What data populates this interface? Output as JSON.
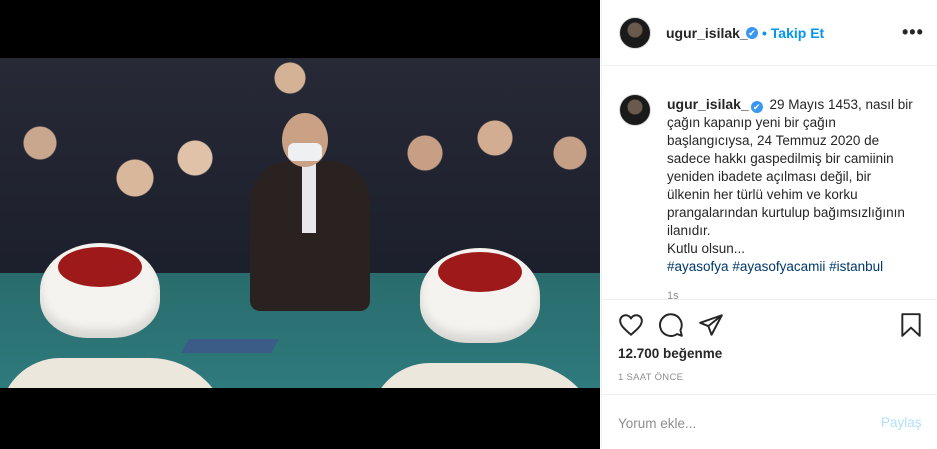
{
  "post": {
    "username": "ugur_isilak_",
    "follow_separator": "•",
    "follow_label": "Takip Et",
    "more_label": "•••",
    "verified_icon": "✔",
    "caption_text": "29 Mayıs 1453, nasıl bir çağın kapanıp yeni bir çağın başlangıcıysa, 24 Temmuz 2020 de sadece hakkı gaspedilmiş bir camiinin yeniden ibadete açılması değil, bir ülkenin her türlü vehim ve korku prangalarından kurtulup bağımsızlığının ilanıdır.",
    "caption_closing": "Kutlu olsun...",
    "hashtags": [
      "#ayasofya",
      "#ayasofyacamii",
      "#istanbul"
    ],
    "caption_time": "1s",
    "likes": "12.700 beğenme",
    "posted_ago": "1 SAAT ÖNCE",
    "comment_placeholder": "Yorum ekle...",
    "post_label": "Paylaş"
  },
  "colors": {
    "accent": "#0095f6",
    "verified": "#3897f0",
    "hashtag": "#00376b",
    "muted": "#8e8e8e",
    "post_disabled": "#b2dffc"
  },
  "icons": [
    "verified-badge-icon",
    "more-options-icon",
    "heart-icon",
    "comment-icon",
    "share-icon",
    "bookmark-icon"
  ]
}
